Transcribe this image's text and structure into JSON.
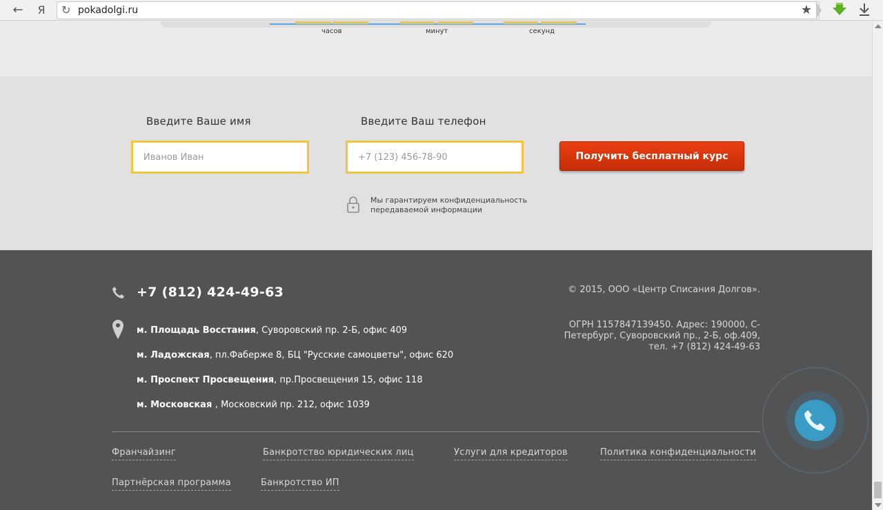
{
  "browser": {
    "back_icon": "arrow-left-icon",
    "yandex_glyph": "Я",
    "url": "pokadolgi.ru"
  },
  "timer": {
    "hours_label": "часов",
    "minutes_label": "минут",
    "seconds_label": "секунд"
  },
  "form": {
    "name_label": "Введите Ваше имя",
    "name_placeholder": "Иванов Иван",
    "phone_label": "Введите Ваш телефон",
    "phone_placeholder": "+7 (123) 456-78-90",
    "submit_label": "Получить бесплатный курс",
    "privacy_line1": "Мы гарантируем конфиденциальность",
    "privacy_line2": "передаваемой информации",
    "accent_color": "#f2c53d",
    "button_color": "#e03a10"
  },
  "footer": {
    "phone": "+7 (812) 424-49-63",
    "addresses": [
      {
        "station": "м. Площадь Восстания",
        "rest": ", Суворовский пр. 2-Б, офис 409"
      },
      {
        "station": "м. Ладожская",
        "rest": ", пл.Фаберже 8, БЦ \"Русские самоцветы\", офис 620"
      },
      {
        "station": "м. Проспект Просвещения",
        "rest": ", пр.Просвещения 15, офис 118"
      },
      {
        "station": "м. Московская ",
        "rest": ", Московский пр. 212, офис 1039"
      }
    ],
    "copyright": "© 2015, ООО «Центр Списания Долгов».",
    "legal_line1": "ОГРН 1157847139450. Адрес: 190000, С-",
    "legal_line2": "Петербург, Суворовский пр., 2-Б, оф.409,",
    "legal_line3": "тел. +7 (812) 424-49-63",
    "links": [
      "Франчайзинг",
      "Банкротство юридических лиц",
      "Услуги для кредиторов",
      "Политика конфиденциальности",
      "Партнёрская программа",
      "Банкротство ИП"
    ],
    "background_color": "#535353"
  }
}
